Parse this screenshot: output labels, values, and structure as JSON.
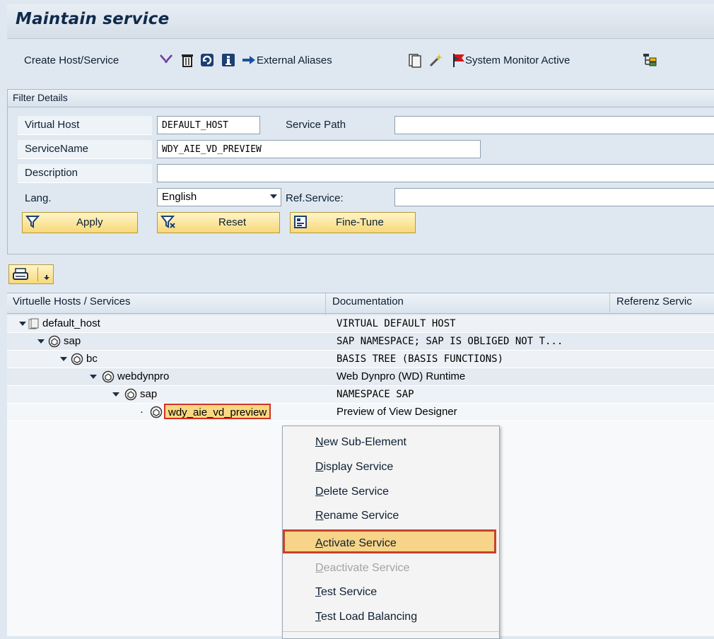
{
  "title": "Maintain service",
  "toolbar": {
    "create_host_service": "Create Host/Service",
    "external_aliases": "External Aliases",
    "system_monitor": "System Monitor Active"
  },
  "filter": {
    "header": "Filter Details",
    "virtual_host_label": "Virtual Host",
    "virtual_host_value": "DEFAULT_HOST",
    "service_path_label": "Service Path",
    "service_path_value": "",
    "service_name_label": "ServiceName",
    "service_name_value": "WDY_AIE_VD_PREVIEW",
    "description_label": "Description",
    "description_value": "",
    "lang_label": "Lang.",
    "lang_value": "English",
    "ref_service_label": "Ref.Service:",
    "ref_service_value": "",
    "apply": "Apply",
    "reset": "Reset",
    "fine_tune": "Fine-Tune"
  },
  "tree": {
    "columns": [
      "Virtuelle Hosts / Services",
      "Documentation",
      "Referenz Servic"
    ],
    "rows": [
      {
        "name": "default_host",
        "doc": "VIRTUAL DEFAULT HOST"
      },
      {
        "name": "sap",
        "doc": "SAP NAMESPACE; SAP IS OBLIGED NOT T..."
      },
      {
        "name": "bc",
        "doc": "BASIS TREE (BASIS FUNCTIONS)"
      },
      {
        "name": "webdynpro",
        "doc": "Web Dynpro (WD) Runtime"
      },
      {
        "name": "sap",
        "doc": "NAMESPACE SAP"
      },
      {
        "name": "wdy_aie_vd_preview",
        "doc": "Preview of View Designer"
      }
    ]
  },
  "context_menu": {
    "items": [
      {
        "label": "New Sub-Element",
        "ul": "N",
        "rest": "ew Sub-Element",
        "enabled": true
      },
      {
        "label": "Display Service",
        "ul": "D",
        "rest": "isplay Service",
        "enabled": true
      },
      {
        "label": "Delete Service",
        "ul": "D",
        "rest": "elete Service",
        "enabled": true
      },
      {
        "label": "Rename Service",
        "ul": "R",
        "rest": "ename Service",
        "enabled": true
      },
      {
        "label": "Activate Service",
        "ul": "A",
        "rest": "ctivate Service",
        "enabled": true
      },
      {
        "label": "Deactivate Service",
        "ul": "D",
        "rest": "eactivate Service",
        "enabled": false
      },
      {
        "label": "Test Service",
        "ul": "T",
        "rest": "est Service",
        "enabled": true
      },
      {
        "label": "Test Load Balancing",
        "ul": "T",
        "rest": "est Load Balancing",
        "enabled": true
      }
    ],
    "highlighted": "Activate Service"
  },
  "colors": {
    "accent": "#c8422c",
    "highlight": "#f7d488",
    "button": "#f7d97a"
  }
}
